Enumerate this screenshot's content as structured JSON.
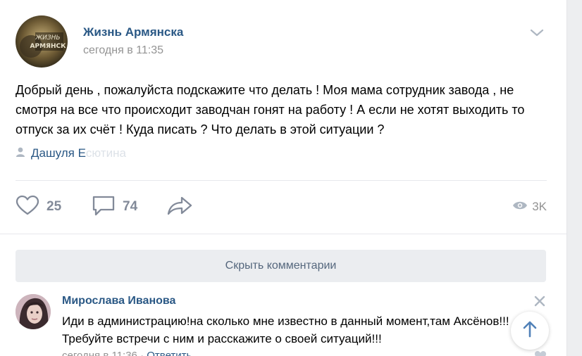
{
  "post": {
    "group_name": "Жизнь Армянска",
    "time": "сегодня в 11:35",
    "text": "Добрый день , пожалуйста подскажите что делать ! Моя мама сотрудник завода , не смотря на все что происходит заводчан гонят на работу ! А если не хотят выходить то отпуск за их счёт ! Куда писать ? Что делать в этой ситуации ?",
    "signer": "Дашуля Е",
    "signer_faded": "сютина",
    "likes": "25",
    "comments": "74",
    "views": "3K",
    "avatar_text": "ЖИЗНЬ АРМЯНСК"
  },
  "hide_comments_label": "Скрыть комментарии",
  "comment": {
    "author": "Мирослава Иванова",
    "text": "Иди в администрацию!на сколько мне известно в данный момент,там Аксёнов!!!Требуйте встречи с ним и расскажите о своей ситуаций!!!",
    "time": "сегодня в 11:36",
    "reply_label": "Ответить"
  },
  "colors": {
    "link": "#2a5885",
    "muted": "#939393",
    "icon": "#828a99",
    "button_bg": "#ebedf0"
  },
  "icons": [
    "chevron-down-icon",
    "person-icon",
    "heart-icon",
    "comment-icon",
    "share-icon",
    "eye-icon",
    "close-icon",
    "arrow-up-icon"
  ]
}
